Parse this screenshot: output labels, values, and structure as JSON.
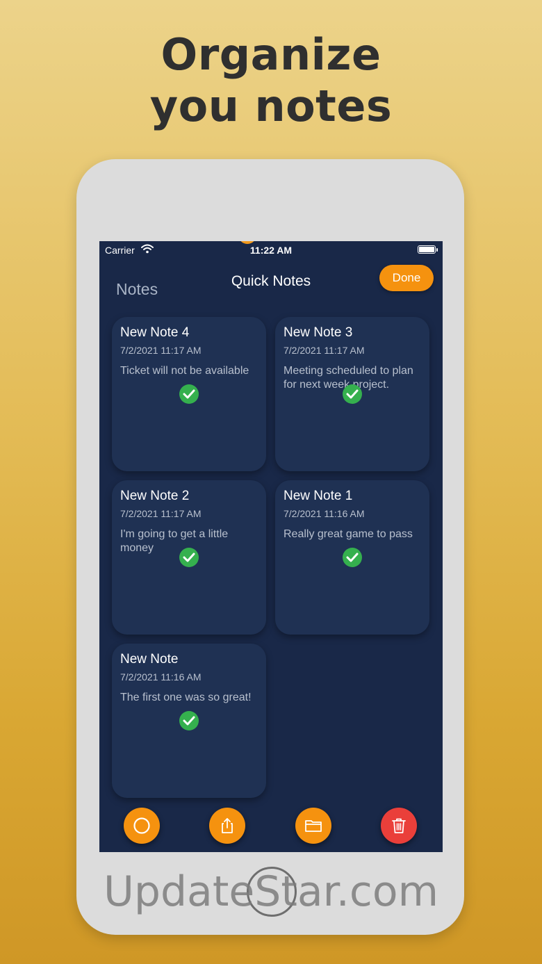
{
  "headline": {
    "line1": "Organize",
    "line2": "you notes"
  },
  "status_bar": {
    "carrier": "Carrier",
    "time": "11:22 AM"
  },
  "nav": {
    "back_label": "Notes",
    "title": "Quick Notes",
    "done_label": "Done"
  },
  "notes": [
    {
      "title": "New Note 4",
      "date": "7/2/2021 11:17 AM",
      "body": "Ticket will not be available",
      "selected": true
    },
    {
      "title": "New Note 3",
      "date": "7/2/2021 11:17 AM",
      "body": "Meeting scheduled to plan for next week project.",
      "selected": true
    },
    {
      "title": "New Note 2",
      "date": "7/2/2021 11:17 AM",
      "body": "I'm going to get a little money",
      "selected": true
    },
    {
      "title": "New Note 1",
      "date": "7/2/2021 11:16 AM",
      "body": "Really great game to pass",
      "selected": true
    },
    {
      "title": "New Note",
      "date": "7/2/2021 11:16 AM",
      "body": "The first one was so great!",
      "selected": true
    }
  ],
  "toolbar": {
    "buttons": [
      {
        "icon": "circle-select-icon",
        "color": "#f5920f"
      },
      {
        "icon": "share-icon",
        "color": "#f5920f"
      },
      {
        "icon": "folder-icon",
        "color": "#f5920f"
      },
      {
        "icon": "trash-icon",
        "color": "#ea3f3a"
      }
    ]
  },
  "watermark": "UpdateStar.com",
  "colors": {
    "accent": "#f5920f",
    "screen_bg": "#192848",
    "card_bg": "#1f3153",
    "check": "#35b04e",
    "delete": "#ea3f3a"
  }
}
